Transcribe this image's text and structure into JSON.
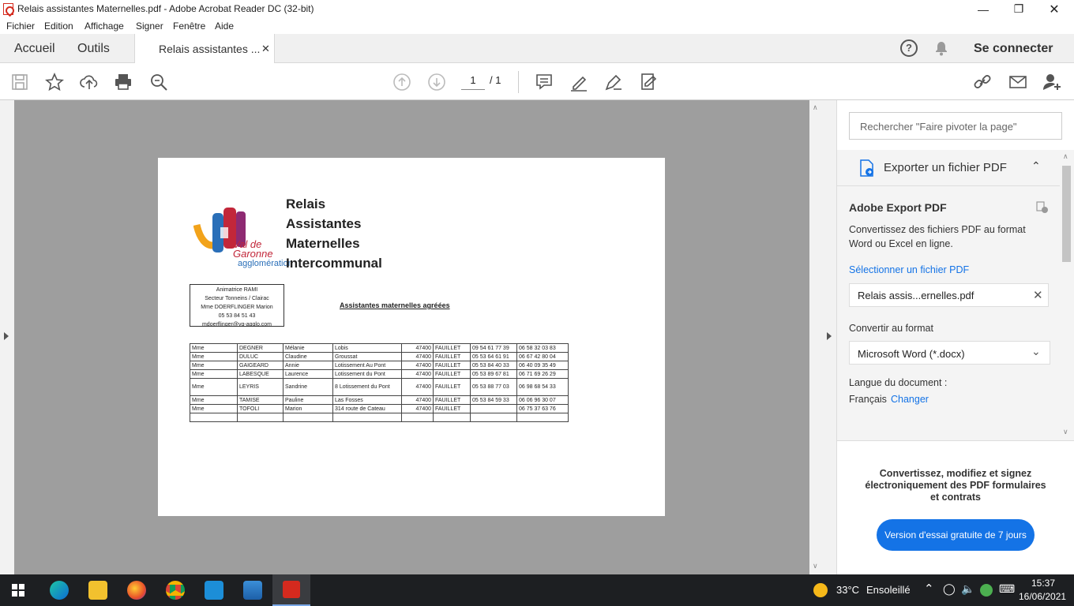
{
  "window": {
    "title": "Relais assistantes Maternelles.pdf - Adobe Acrobat Reader DC (32-bit)"
  },
  "menu": [
    "Fichier",
    "Edition",
    "Affichage",
    "Signer",
    "Fenêtre",
    "Aide"
  ],
  "tabs": {
    "home": "Accueil",
    "tools": "Outils",
    "document": "Relais assistantes ...",
    "sign_in": "Se connecter"
  },
  "toolbar": {
    "page_current": "1",
    "page_total": "/ 1"
  },
  "document": {
    "logo_lines": [
      "Val de",
      "Garonne",
      "agglomération"
    ],
    "heading_lines": [
      "Relais",
      "Assistantes",
      "Maternelles",
      "Intercommunal"
    ],
    "contact_box": [
      "Animatrice RAMI",
      "Secteur Tonneins / Clairac",
      "Mme DOERFLINGER Marion",
      "05 53 84 51 43",
      "mdoerflinger@vg-agglo.com"
    ],
    "subtitle": "Assistantes maternelles agréées",
    "rows": [
      [
        "Mme",
        "DEGNER",
        "Mélanie",
        "Lobis",
        "47400",
        "FAUILLET",
        "09 54 61 77 39",
        "06 58 32 03 83"
      ],
      [
        "Mme",
        "DULUC",
        "Claudine",
        "Groussat",
        "47400",
        "FAUILLET",
        "05 53 64 61 91",
        "06 67 42 80 04"
      ],
      [
        "Mme",
        "GAIGEARD",
        "Annie",
        "Lotissement Au Pont",
        "47400",
        "FAUILLET",
        "05 53 84 40 33",
        "06 40 09 35 49"
      ],
      [
        "Mme",
        "LABESQUE",
        "Laurence",
        "Lotissement du Pont",
        "47400",
        "FAUILLET",
        "05 53 89 67 81",
        "06 71 69 26 29"
      ],
      [
        "Mme",
        "LEYRIS",
        "Sandrine",
        "8 Lotissement du Pont",
        "47400",
        "FAUILLET",
        "05 53 88 77 03",
        "06 98 68 54 33"
      ],
      [
        "Mme",
        "TAMISE",
        "Pauline",
        "Las Fosses",
        "47400",
        "FAUILLET",
        "05 53 84 59 33",
        "06 06 96 30 07"
      ],
      [
        "Mme",
        "TOFOLI",
        "Marion",
        "314 route de Cateau",
        "47400",
        "FAUILLET",
        "",
        "06 75 37 63 76"
      ],
      [
        "",
        "",
        "",
        "",
        "",
        "",
        "",
        ""
      ]
    ]
  },
  "panel": {
    "search_placeholder": "Rechercher \"Faire pivoter la page\"",
    "export_title": "Exporter un fichier PDF",
    "adobe_export": "Adobe Export PDF",
    "description": "Convertissez des fichiers PDF au format Word ou Excel en ligne.",
    "select_file": "Sélectionner un fichier PDF",
    "file_name": "Relais assis...ernelles.pdf",
    "convert_label": "Convertir au format",
    "format": "Microsoft Word (*.docx)",
    "language_label": "Langue du document :",
    "language": "Français",
    "change": "Changer",
    "promo": "Convertissez, modifiez et signez électroniquement des PDF formulaires et contrats",
    "trial_button": "Version d'essai gratuite de 7 jours"
  },
  "taskbar": {
    "weather_temp": "33°C",
    "weather_desc": "Ensoleillé",
    "time": "15:37",
    "date": "16/06/2021"
  },
  "colors": {
    "accent": "#1473e6",
    "acrobat_red": "#d42a1e",
    "doc_bg": "#9e9e9e"
  }
}
